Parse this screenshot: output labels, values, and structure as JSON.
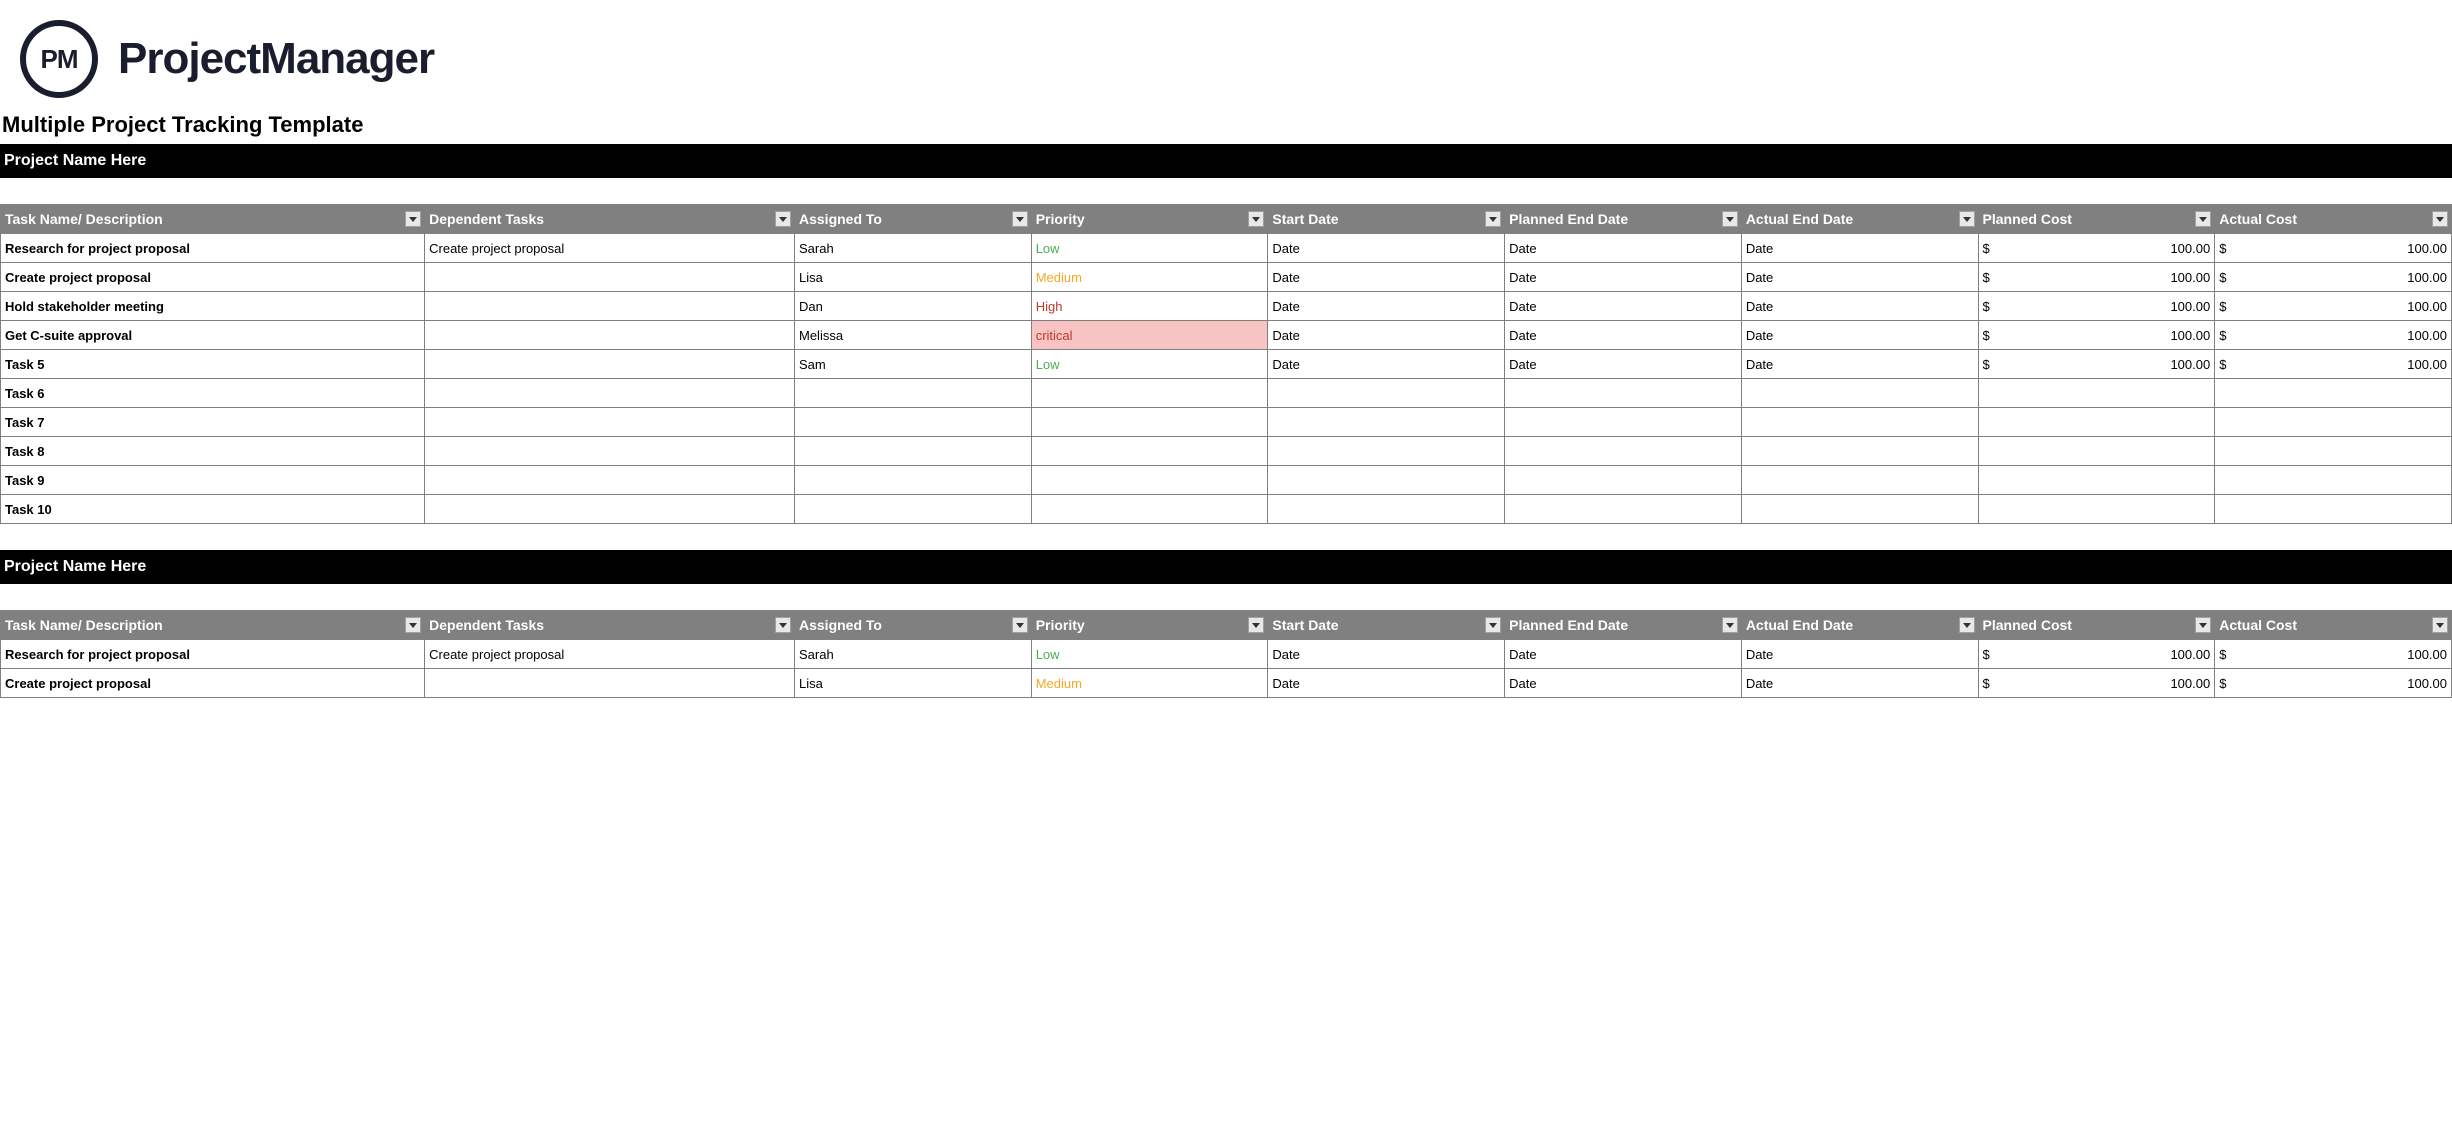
{
  "logo": {
    "initials": "PM",
    "text": "ProjectManager"
  },
  "template_title": "Multiple Project Tracking Template",
  "columns": {
    "task": "Task Name/ Description",
    "dependent": "Dependent Tasks",
    "assigned": "Assigned To",
    "priority": "Priority",
    "start": "Start Date",
    "planned_end": "Planned End Date",
    "actual_end": "Actual End Date",
    "planned_cost": "Planned Cost",
    "actual_cost": "Actual Cost"
  },
  "currency_symbol": "$",
  "projects": [
    {
      "name": "Project Name Here",
      "rows": [
        {
          "task": "Research for project proposal",
          "dependent": "Create project proposal",
          "assigned": "Sarah",
          "priority": "Low",
          "start": "Date",
          "planned_end": "Date",
          "actual_end": "Date",
          "planned_cost": "100.00",
          "actual_cost": "100.00"
        },
        {
          "task": "Create project proposal",
          "dependent": "",
          "assigned": "Lisa",
          "priority": "Medium",
          "start": "Date",
          "planned_end": "Date",
          "actual_end": "Date",
          "planned_cost": "100.00",
          "actual_cost": "100.00"
        },
        {
          "task": "Hold stakeholder meeting",
          "dependent": "",
          "assigned": "Dan",
          "priority": "High",
          "start": "Date",
          "planned_end": "Date",
          "actual_end": "Date",
          "planned_cost": "100.00",
          "actual_cost": "100.00"
        },
        {
          "task": "Get C-suite approval",
          "dependent": "",
          "assigned": "Melissa",
          "priority": "critical",
          "start": "Date",
          "planned_end": "Date",
          "actual_end": "Date",
          "planned_cost": "100.00",
          "actual_cost": "100.00"
        },
        {
          "task": "Task 5",
          "dependent": "",
          "assigned": "Sam",
          "priority": "Low",
          "start": "Date",
          "planned_end": "Date",
          "actual_end": "Date",
          "planned_cost": "100.00",
          "actual_cost": "100.00"
        },
        {
          "task": "Task 6"
        },
        {
          "task": "Task 7"
        },
        {
          "task": "Task 8"
        },
        {
          "task": "Task 9"
        },
        {
          "task": "Task 10"
        }
      ]
    },
    {
      "name": "Project Name Here",
      "rows": [
        {
          "task": "Research for project proposal",
          "dependent": "Create project proposal",
          "assigned": "Sarah",
          "priority": "Low",
          "start": "Date",
          "planned_end": "Date",
          "actual_end": "Date",
          "planned_cost": "100.00",
          "actual_cost": "100.00"
        },
        {
          "task": "Create project proposal",
          "dependent": "",
          "assigned": "Lisa",
          "priority": "Medium",
          "start": "Date",
          "planned_end": "Date",
          "actual_end": "Date",
          "planned_cost": "100.00",
          "actual_cost": "100.00"
        }
      ]
    }
  ]
}
